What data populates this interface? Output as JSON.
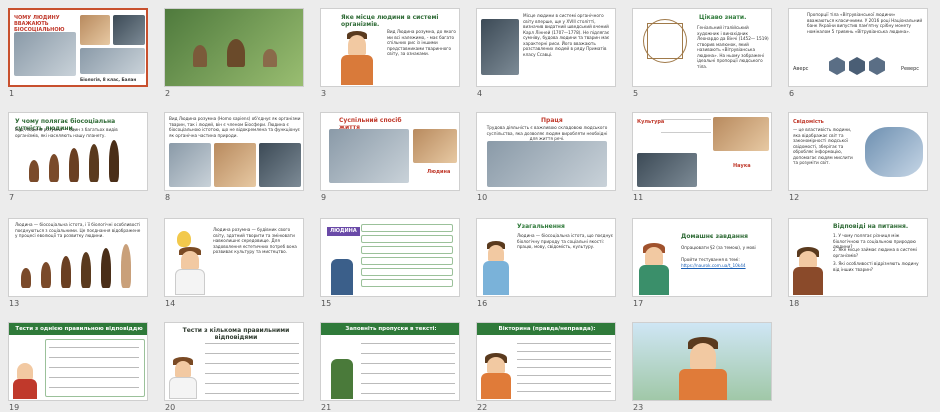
{
  "slides": [
    {
      "num": "1",
      "title": "ЧОМУ ЛЮДИНУ ВВАЖАЮТЬ БІОСОЦІАЛЬНОЮ ІСТОТОЮ",
      "caption": "Біологія, 8 клас, Балан",
      "selected": true
    },
    {
      "num": "2"
    },
    {
      "num": "3",
      "title": "Яке місце людини в системі організмів.",
      "body": "Вид Людина розумна, до якого ми всі належимо, - має багато спільних рис із іншими представниками тваринного світу, за ознаками."
    },
    {
      "num": "4",
      "body": "Місце людини в системі органічного світу вперше, ще у XVIII столітті, визначив видатний шведський вчений Карл Лінней (1707—1778). Не підлягає сумніву, будова людини та тварин має характерні риси. Його вважають розставлених людей в ряду Приматів класу Ссавці.",
      "accent": "Карл Лінней (1707—1778)."
    },
    {
      "num": "5",
      "title": "Цікаво знати.",
      "body": "Геніальний італійський художник і винахідник Леонардо да Вінчі (1452— 1519) створив малюнок, який називають «Вітрувіанська людина». На ньому зображені ідеальні пропорції людського тіла."
    },
    {
      "num": "6",
      "body": "Пропорції тіла «Вітрувіанської людини» вважаються класичними. У 2016 році Національний банк України випустив пам'ятну срібну монету номіналом 5 гривень «Вітрувіанська людина».",
      "left_label": "Аверс",
      "right_label": "Реверс"
    },
    {
      "num": "7",
      "title": "У чому полягає біосоціальна сутність людини.",
      "body": "Вид Людина розумна — один з багатьох видів організмів, які населяють нашу планету."
    },
    {
      "num": "8",
      "body": "Вид Людина розумна (Homo sapiens) об'єднує як організми тварин, так і людей, він є членом Біосфери. Людина є біосоціальною істотою, що не відокремлена та функціонує як органічна частина природи."
    },
    {
      "num": "9",
      "title": "Суспільний спосіб життя",
      "note": "Людина"
    },
    {
      "num": "10",
      "title": "Праця",
      "body": "Трудова діяльність є важливою складовою людського суспільства, яка дозволяє людям виробляти необхідні для життя речі."
    },
    {
      "num": "11",
      "label_a": "Культура",
      "label_b": "Наука"
    },
    {
      "num": "12",
      "accent": "Свідомість",
      "body": "— це властивість людини, яка відображає світ та закономірності людської свідомості, зберігає та обробляє інформацію, допомагає людям мислити та розуміти світ."
    },
    {
      "num": "13",
      "body": "Людина — біосоціальна істота, і її біологічні особливості поєднуються з соціальними. Це поєднання відображене у процесі еволюції та розвитку людини."
    },
    {
      "num": "14",
      "body": "Людина розумна — будівник свого світу, здатний творити та змінювати навколишнє середовище. Для задоволення естетичних потреб вона розвиває культуру та мистецтво."
    },
    {
      "num": "15",
      "label": "ЛЮДИНА"
    },
    {
      "num": "16",
      "title": "Узагальнення",
      "body": "Людина — біосоціальна істота, що поєднує біологічну природу та соціальні якості: працю, мову, свідомість, культуру."
    },
    {
      "num": "17",
      "title": "Домашнє завдання",
      "items": [
        "Опрацювати §2 (за темою), у мові",
        "Пройти тестування в темі:",
        "https://naurok.com.ua/t_10k44"
      ]
    },
    {
      "num": "18",
      "title": "Відповіді на питання.",
      "items": [
        "1. У чому полягає різниця між біологічною та соціальною природою людини?",
        "2. Яке місце займає людина в системі організмів?",
        "3. Які особливості відрізняють людину від інших тварин?"
      ]
    },
    {
      "num": "19",
      "title": "Тести з однією правильною відповіддю"
    },
    {
      "num": "20",
      "title": "Тести з кількома правильними відповідями"
    },
    {
      "num": "21",
      "title": "Заповніть пропуски в тексті:"
    },
    {
      "num": "22",
      "title": "Вікторина (правда/неправда):"
    },
    {
      "num": "23"
    }
  ]
}
